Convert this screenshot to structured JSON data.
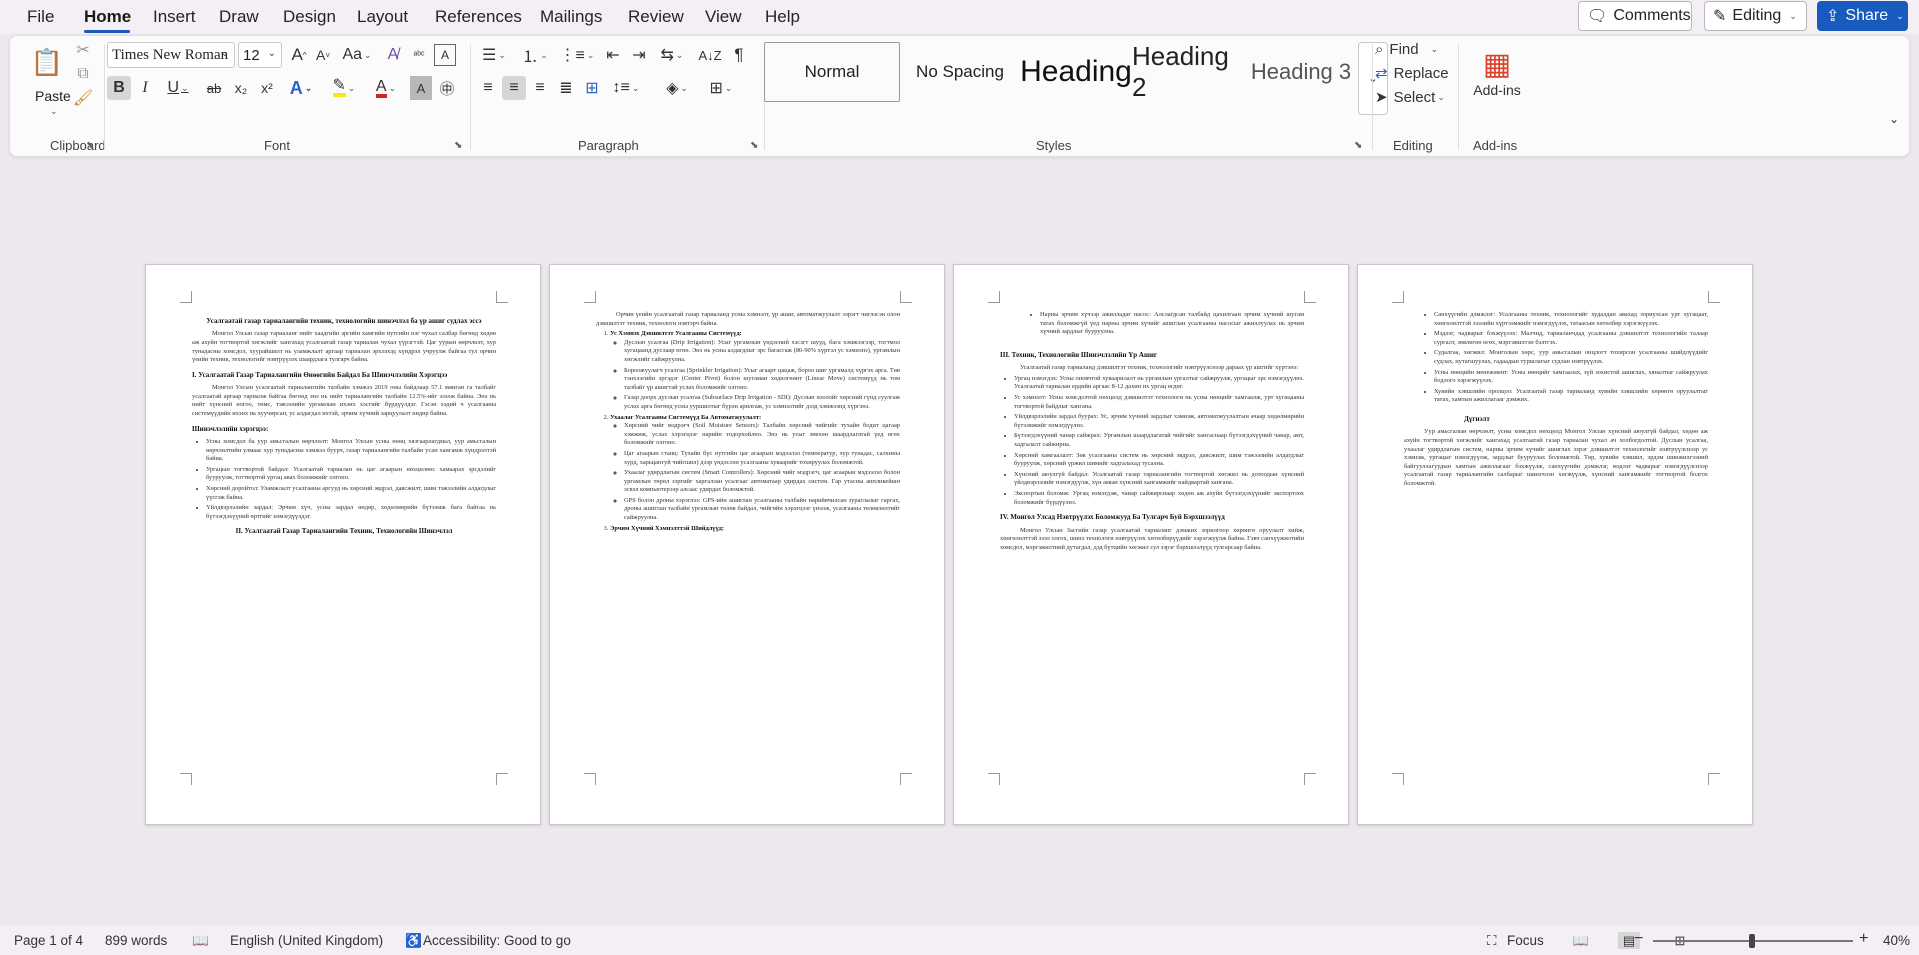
{
  "menubar": {
    "tabs": [
      "File",
      "Home",
      "Insert",
      "Draw",
      "Design",
      "Layout",
      "References",
      "Mailings",
      "Review",
      "View",
      "Help"
    ],
    "active": "Home",
    "comments": "Comments",
    "editing": "Editing",
    "share": "Share"
  },
  "ribbon": {
    "clipboard": {
      "label": "Clipboard",
      "paste": "Paste"
    },
    "font": {
      "label": "Font",
      "family": "Times New Roman",
      "size": "12",
      "bold": "B",
      "italic": "I",
      "underline": "U",
      "strike": "ab",
      "subscript": "x₂",
      "superscript": "x²",
      "change_case": "Aa",
      "grow": "A",
      "shrink": "A"
    },
    "paragraph": {
      "label": "Paragraph"
    },
    "styles": {
      "label": "Styles",
      "items": [
        "Normal",
        "No Spacing",
        "Heading",
        "Heading 2",
        "Heading 3"
      ]
    },
    "editing": {
      "label": "Editing",
      "find": "Find",
      "replace": "Replace",
      "select": "Select"
    },
    "addins": {
      "label": "Add-ins",
      "button": "Add-ins"
    }
  },
  "document": {
    "page1": {
      "title": "Усалгаатай газар тариалангийн техник, технологийн шинэчлэл ба үр ашиг судлах эссэ",
      "p1": "Монгол Улсын газар тариаланг нийт хаадгийн эргийн хамгийн нутгийн нэг чухал салбар бөгөөд хөдөө аж ахуйн тогтвортой хөгжлийг хангахад усалгаатай газар тариалан чухал үүрэгтэй. Цаг уурын өөрчлөлт, хур тунадасны хомсдол, хуурайшилт нь уламжлалт аргаар тариалан эрхлэхэд хүндрэл учруулж байгаа тул орчин үеийн техник, технологийг нэвтрүүлэх шаардлага тулгарч байна.",
      "h1": "I. Усалгаатай Газар Тариалангийн Өнөөгийн Байдал Ба Шинэчлэлийн Хэрэгцээ",
      "p2": "Монгол Улсын усалгаатай тариалангийн талбайн хэмжээ 2019 оны байдлаар 57.1 мянган га талбайг усалгаатай аргаар тариалж байгаа бөгөөд энэ нь нийт тариалангийн талбайн 12.5%-ийг эзэлж байна. Энэ нь нийт хүнсний ногоо, төмс, тэжээлийн ургамлын ихэнх хэсгийг бүрдүүлдэг. Гэсэн хэдий ч усалгааны системүүдийн ихэнх нь хуучирсан, ус алдагдал ихтэй, эрчим хүчний зарцуулалт өндөр байна.",
      "h2": "Шинэчлэлийн хэрэгцээ:",
      "bullets": [
        "Усны хомсдол ба уур амьсгалын өөрчлөлт: Монгол Улсын усны нөөц хязгаарлагдмал, уур амьсгалын өөрчлөлтийн улмаас хур тунадасны хэмжээ буурч, газар тариалангийн талбайн усан хангамж хүндрэлтэй байна.",
        "Ургацын тогтвортой байдал: Усалгаатай тариалан нь цаг агаарын нөхцөлөөс хамаарах эрсдэлийг бууруулж, тогтвортой ургац авах боломжийг олгоно.",
        "Хөрсний доройтол: Уламжлалт усалгааны аргууд нь хөрсний эвдрэл, давсжилт, шим тэжээлийн алдагдлыг үүсгэж байна.",
        "Үйлдвэрлэлийн зардал: Эрчим хүч, усны зардал өндөр, хөдөлмөрийн бүтээмж бага байгаа нь бүтээгдэхүүний өртгийг нэмэгдүүлдэг."
      ],
      "h3": "II. Усалгаатай Газар Тариалангийн Техник, Технологийн Шинэчлэл"
    },
    "page2": {
      "p1": "Орчин үеийн усалгаатай газар тариаланд усны хэмнэлт, үр ашиг, автоматжуулалт зэрэгт чиглэсэн олон дэвшилтэт техник, технологи нэвтэрч байна.",
      "n1": "Ус Хэмнэх Дэвшилтэт Усалгааны Системүүд:",
      "s1": [
        "Дуслын усалгаа (Drip Irrigation): Усыг ургамлын үндэсний хэсэгт шууд, бага хэмжээгээр, тогтмол хугацаанд дуслаар өгнө. Энэ нь усны алдагдлыг эрс багасгаж (80-90% хүртэл ус хэмнэнэ), ургамлын хөгжлийг сайжруулна.",
        "Бороожуулагч усалгаа (Sprinkler Irrigation): Усыг агаарт цацаж, бороо шиг ургамалд хүргэх арга. Төв тэнхлэгийн эргэдэг (Center Pivot) болон шугаман хөдөлгөөнт (Linear Move) системүүд нь том талбайг үр ашигтай услах боломжийг олгоно.",
        "Газар доорх дуслын усалгаа (Subsurface Drip Irrigation - SDI): Дуслын хоолойг хөрсний гүнд суулгаж услах арга бөгөөд усны ууршилтыг бүрэн арилгаж, ус хэмнэлтийг дээд хэмжээнд хүргэнэ."
      ],
      "n2": "Ухаалаг Усалгааны Системүүд Ба Автоматжуулалт:",
      "s2": [
        "Хөрсний чийг мэдрэгч (Soil Moisture Sensors): Талбайн хөрсний чийгийг тухайн бодит цагаар хэмжиж, услах хэрэгцээг нарийн тодорхойлно. Энэ нь усыг зөвхөн шаардлагатай үед өгөх боломжийг олгоно.",
        "Цаг агаарын станц: Тухайн бүс нутгийн цаг агаарын мэдээлэл (температур, хур тунадас, салхины хурд, харьцангуй чийгшил) дээр үндэслэн усалгааны хуваарийг тохируулах боломжтой.",
        "Ухаалаг удирдлагын систем (Smart Controllers): Хөрсний чийг мэдрэгч, цаг агаарын мэдээлэл болон ургамлын төрөл зэргийг харгалзан усалгааг автоматаар удирдах систем. Гар утасны аппликейшн эсвэл компьютерээр алсаас удирдах боломжтой.",
        "GPS болон дроны хэрэглээ: GPS-ийн ашиглан усалгааны талбайн нарийвчилсан зураглалыг гаргах, дроны ашиглан талбайн ургамлын төлөв байдал, чийгийн хэрэгцээг үнэлж, усалгааны төлөвлөлтийг сайжруулна."
      ],
      "n3": "Эрчим Хүчний Хэмнэлттэй Шийдлүүд:"
    },
    "page3": {
      "b1": "Нарны эрчим хүчээр ажилладаг насос: Алслагдсан талбайд цахилгаан эрчим хүчний шугам татах боломжгүй үед нарны эрчим хүчийг ашиглан усалгааны насосыг ажиллуулах нь эрчим хүчний зардлыг бууруулна.",
      "h1": "III. Техник, Технологийн Шинэчлэлийн Үр Ашиг",
      "p1": "Усалгаатай газар тариаланд дэвшилтэт техник, технологийг нэвтрүүлснээр дараах үр ашгийг хүртэнэ:",
      "bullets": [
        "Ургац нэмэгдэх: Усны оновчтой хуваарилалт нь ургамлын ургалтыг сайжруулж, ургацыг эрс нэмэгдүүлнэ. Усалгаатай тариалан ердийн аргаас 8-12 дахин их ургац өгдөг.",
        "Ус хэмнэлт: Усны хомсдолтой нөхцөлд дэвшилтэт технологи нь усны нөөцийг хамгаалж, урт хугацааны тогтвортой байдлыг хангана.",
        "Үйлдвэрлэлийн зардал буурах: Ус, эрчим хүчний зардлыг хэмнэж, автоматжуулалтын ачаар хөдөлмөрийн бүтээмжийг нэмэгдүүлнэ.",
        "Бүтээгдэхүүний чанар сайжрах: Ургамлын шаардлагатай чийгийг хангаснаар бүтээгдэхүүний чанар, амт, хадгалалт сайжирна.",
        "Хөрсний хамгаалалт: Зөв усалгааны систем нь хөрсний эвдрэл, давсжилт, шим тэжээлийн алдагдлыг бууруулж, хөрсний үржил шимийг хадгалахад тусална.",
        "Хүнсний аюулгүй байдал: Усалгаатай газар тариалангийн тогтвортой хөгжил нь дотоодын хүнсний үйлдвэрлэлийг нэмэгдүүлж, хүн амын хүнсний хангамжийг найдвартай хангана.",
        "Экспортын боломж: Ургац нэмэгдэж, чанар сайжирснаар хөдөө аж ахуйн бүтээгдэхүүнийг экспортлох боломжийг бүрдүүлнэ."
      ],
      "h2": "IV. Монгол Улсад Нэвтрүүлэх Боломжууд Ба Тулгарч Буй Бэрхшээлүүд",
      "p2": "Монгол Улсын Засгийн газар усалгаатай тариаланг дэмжих зорилгоор хөрөнгө оруулалт хийж, хөнгөлөлттэй зээл олгох, шинэ технологи нэвтрүүлэх хөтөлбөрүүдийг хэрэгжүүлж байна. Гэвч санхүүжилтийн хомсдол, мэргэжилтний дутагдал, дэд бүтцийн хөгжил сул зэрэг бэрхшээлүүд тулгарсаар байна."
    },
    "page4": {
      "bullets": [
        "Санхүүгийн дэмжлэг: Усалгааны техник, технологийг худалдан авахад зориулсан урт хугацаат, хөнгөлөлттэй зээлийн хүртээмжийг нэмэгдүүлэх, татаасын хөтөлбөр хэрэгжүүлэх.",
        "Мэдлэг, чадварыг бэхжүүлэх: Малчид, тариаланчдад усалгааны дэвшилтэт технологийн талаар сургалт, зөвлөгөө өгөх, мэргэжилтэн бэлтгэх.",
        "Судалгаа, хөгжил: Монголын хөрс, уур амьсгалын онцлогт тохирсон усалгааны шийдлүүдийг судлах, нутагшуулах, гадаадын туршлагыг судлан нэвтрүүлэх.",
        "Усны нөөцийн менежмент: Усны нөөцийг хамгаалах, зүй зохистой ашиглах, хяналтыг сайжруулах бодлого хэрэгжүүлэх.",
        "Хувийн хэвшлийн оролцоо: Усалгаатай газар тариаланд хувийн хэвшлийн хөрөнгө оруулалтыг татах, хамтын ажиллагааг дэмжих."
      ],
      "h1": "Дүгнэлт",
      "p1": "Уур амьсгалын өөрчлөлт, усны хомсдол нөхцөлд Монгол Улсын хүнсний аюулгүй байдал, хөдөө аж ахуйн тогтвортой хөгжлийг хангахад усалгаатай газар тариалан чухал ач холбогдолтой. Дуслын усалгаа, ухаалаг удирдлагын систем, нарны эрчим хүчийг ашиглах зэрэг дэвшилтэт технологийг нэвтрүүлснээр ус хэмнэж, ургацыг нэмэгдүүлж, зардлыг бууруулах боломжтой. Төр, хувийн хэвшил, эрдэм шинжилгээний байгууллагуудын хамтын ажиллагааг бэхжүүлж, санхүүгийн дэмжлэг, мэдлэг чадварыг нэмэгдүүлснээр усалгаатай газар тариалангийн салбарыг шинэчлэн хөгжүүлж, хүнсний хангамжийг тогтвортой болгох боломжтой."
    }
  },
  "status": {
    "page": "Page 1 of 4",
    "words": "899 words",
    "language": "English (United Kingdom)",
    "accessibility": "Accessibility: Good to go",
    "focus": "Focus",
    "zoom": "40%",
    "zoom_fraction": 0.5
  }
}
